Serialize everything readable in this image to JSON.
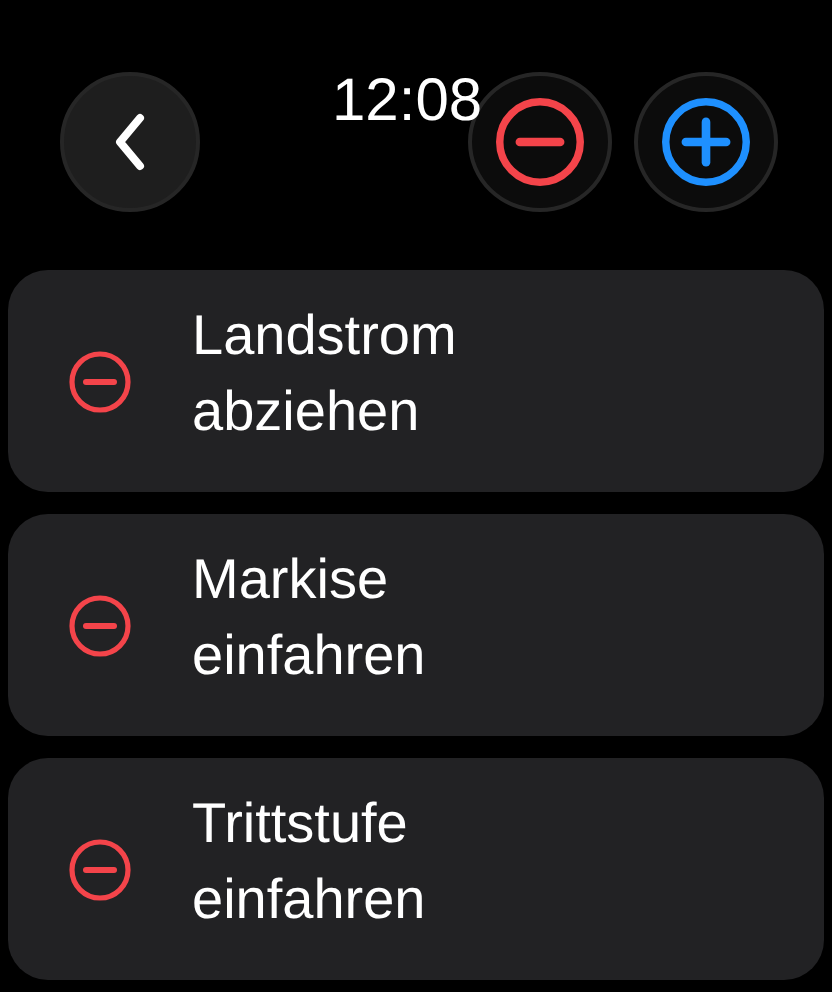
{
  "header": {
    "time": "12:08",
    "buttons": [
      {
        "kind": "remove"
      },
      {
        "kind": "add"
      }
    ]
  },
  "items": [
    {
      "kind": "remove",
      "label": "Landstrom abziehen"
    },
    {
      "kind": "remove",
      "label": "Markise einfahren"
    },
    {
      "kind": "remove",
      "label": "Trittstufe einfahren"
    }
  ]
}
